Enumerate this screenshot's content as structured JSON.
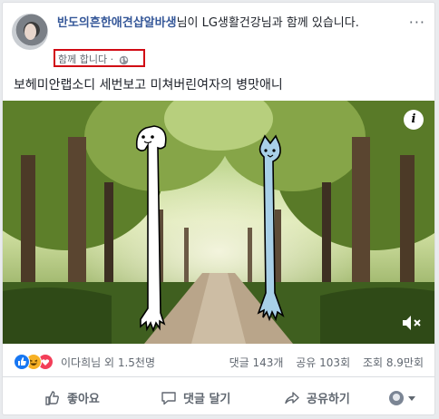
{
  "post": {
    "author": "반도의흔한애견샵알바생",
    "headline_rest": "님이 LG생활건강님과 함께 있습니다.",
    "with_label": "함께 합니다",
    "separator": "·",
    "more": "···",
    "text": "보헤미안랩소디 세번보고 미쳐버린여자의 병맛애니",
    "info": "i"
  },
  "stats": {
    "reactors": "이다희님 외 1.5천명",
    "comments": "댓글 143개",
    "shares": "공유 103회",
    "views": "조회 8.9만회"
  },
  "actions": {
    "like": "좋아요",
    "comment": "댓글 달기",
    "share": "공유하기"
  },
  "colors": {
    "link": "#365899",
    "highlight_box": "#d10a14",
    "like": "#1877f2",
    "haha": "#f7b125",
    "love": "#f33e58"
  }
}
